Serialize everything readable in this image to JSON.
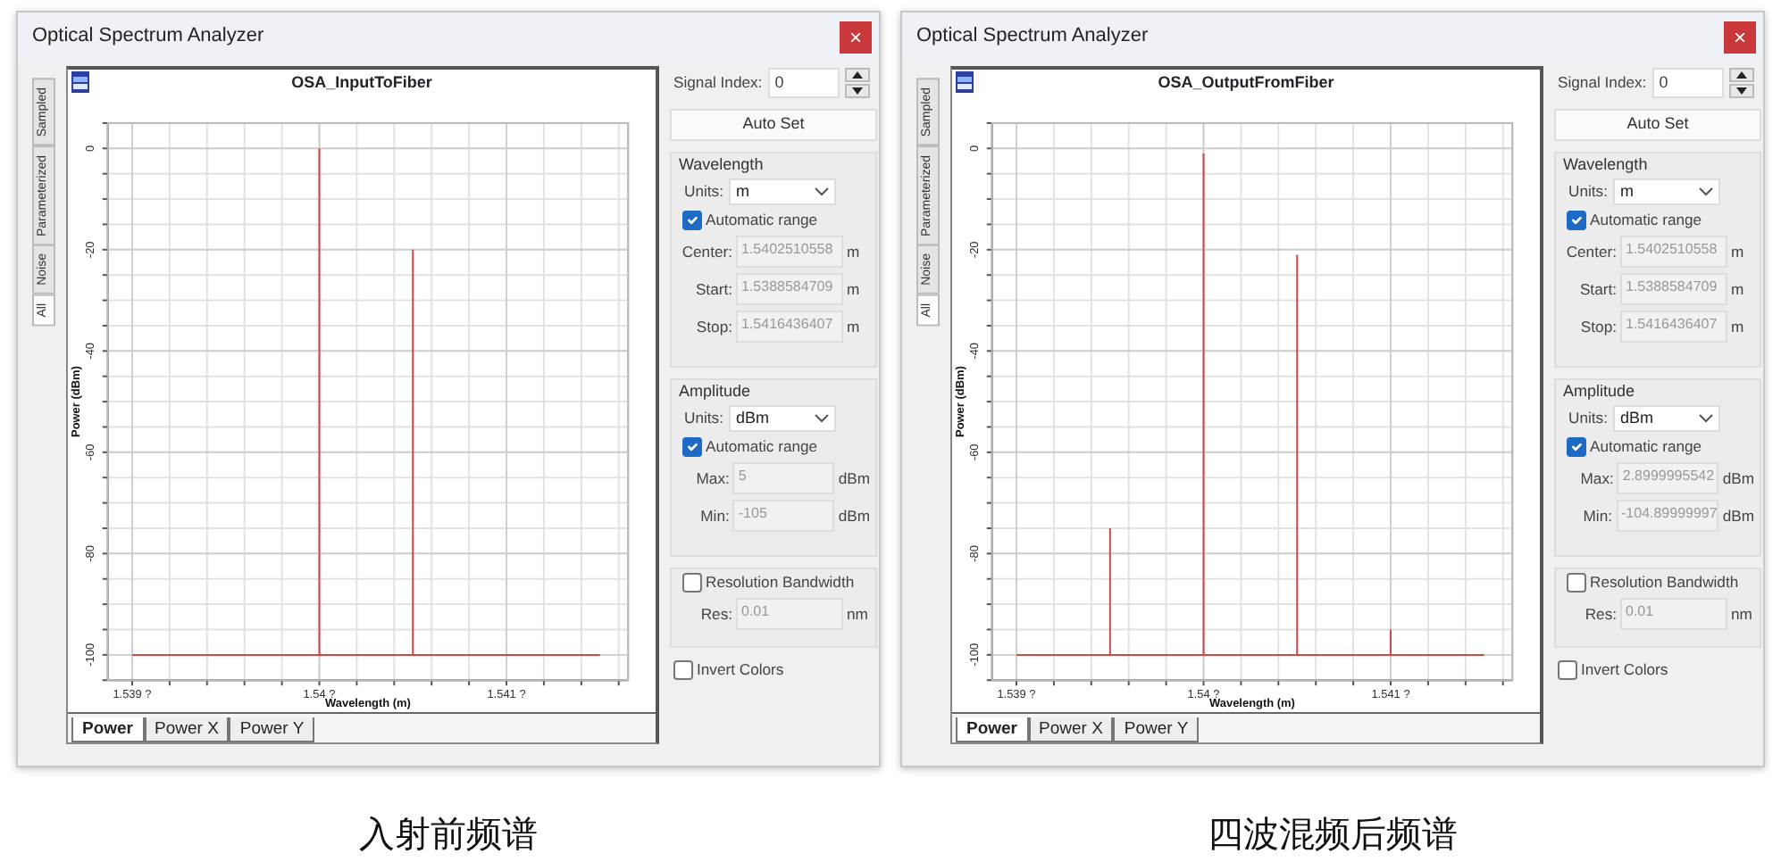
{
  "windows": [
    {
      "title": "Optical Spectrum Analyzer",
      "close": "×",
      "side_tabs": [
        {
          "label": "Sampled",
          "selected": false
        },
        {
          "label": "Parameterized",
          "selected": false
        },
        {
          "label": "Noise",
          "selected": false
        },
        {
          "label": "All",
          "selected": true
        }
      ],
      "plot_title": "OSA_InputToFiber",
      "chart_data": {
        "type": "line",
        "grid": true,
        "xlabel": "Wavelength (m)",
        "ylabel": "Power (dBm)",
        "xlim": [
          1.53887,
          1.54165
        ],
        "ylim": [
          -105,
          5
        ],
        "xticks": [
          {
            "value": 1.539,
            "label": "1.539 ?"
          },
          {
            "value": 1.54,
            "label": "1.54 ?"
          },
          {
            "value": 1.541,
            "label": "1.541 ?"
          }
        ],
        "yticks": [
          0,
          -20,
          -40,
          -60,
          -80,
          -100
        ],
        "x": [
          1.539,
          1.54,
          1.54,
          1.54,
          1.5405,
          1.5405,
          1.5405,
          1.5415
        ],
        "series": [
          {
            "color": "#d04848",
            "values": [
              -100,
              -100,
              0,
              -100,
              -100,
              -20,
              -100,
              -100
            ]
          }
        ]
      },
      "bottom_tabs": [
        {
          "label": "Power",
          "selected": true
        },
        {
          "label": "Power X",
          "selected": false
        },
        {
          "label": "Power Y",
          "selected": false
        }
      ],
      "panel": {
        "signal_index": {
          "label": "Signal Index:",
          "value": "0"
        },
        "auto_set": "Auto Set",
        "groups": [
          {
            "title": "Wavelength",
            "units_label": "Units:",
            "units": "m",
            "automatic_range": {
              "label": "Automatic range",
              "checked": true
            },
            "fields": [
              {
                "label": "Center:",
                "value": "1.5402510558",
                "unit": "m",
                "disabled": true
              },
              {
                "label": "Start:",
                "value": "1.5388584709",
                "unit": "m",
                "disabled": true
              },
              {
                "label": "Stop:",
                "value": "1.5416436407",
                "unit": "m",
                "disabled": true
              }
            ]
          },
          {
            "title": "Amplitude",
            "units_label": "Units:",
            "units": "dBm",
            "automatic_range": {
              "label": "Automatic range",
              "checked": true
            },
            "fields": [
              {
                "label": "Max:",
                "value": "5",
                "unit": "dBm",
                "disabled": true
              },
              {
                "label": "Min:",
                "value": "-105",
                "unit": "dBm",
                "disabled": true
              }
            ]
          }
        ],
        "resolution_bandwidth": {
          "label": "Resolution Bandwidth",
          "checked": false,
          "field": {
            "label": "Res:",
            "value": "0.01",
            "unit": "nm",
            "disabled": true
          }
        },
        "invert_colors": {
          "label": "Invert Colors",
          "checked": false
        }
      },
      "caption": "入射前频谱"
    },
    {
      "title": "Optical Spectrum Analyzer",
      "close": "×",
      "side_tabs": [
        {
          "label": "Sampled",
          "selected": false
        },
        {
          "label": "Parameterized",
          "selected": false
        },
        {
          "label": "Noise",
          "selected": false
        },
        {
          "label": "All",
          "selected": true
        }
      ],
      "plot_title": "OSA_OutputFromFiber",
      "chart_data": {
        "type": "line",
        "grid": true,
        "xlabel": "Wavelength (m)",
        "ylabel": "Power (dBm)",
        "xlim": [
          1.53887,
          1.54165
        ],
        "ylim": [
          -105,
          5
        ],
        "xticks": [
          {
            "value": 1.539,
            "label": "1.539 ?"
          },
          {
            "value": 1.54,
            "label": "1.54 ?"
          },
          {
            "value": 1.541,
            "label": "1.541 ?"
          }
        ],
        "yticks": [
          0,
          -20,
          -40,
          -60,
          -80,
          -100
        ],
        "x": [
          1.539,
          1.5395,
          1.5395,
          1.5395,
          1.54,
          1.54,
          1.54,
          1.5405,
          1.5405,
          1.5405,
          1.541,
          1.541,
          1.541,
          1.5415
        ],
        "series": [
          {
            "color": "#d04848",
            "values": [
              -100,
              -100,
              -75,
              -100,
              -100,
              -1,
              -100,
              -100,
              -21,
              -100,
              -100,
              -95,
              -100,
              -100
            ]
          }
        ]
      },
      "bottom_tabs": [
        {
          "label": "Power",
          "selected": true
        },
        {
          "label": "Power X",
          "selected": false
        },
        {
          "label": "Power Y",
          "selected": false
        }
      ],
      "panel": {
        "signal_index": {
          "label": "Signal Index:",
          "value": "0"
        },
        "auto_set": "Auto Set",
        "groups": [
          {
            "title": "Wavelength",
            "units_label": "Units:",
            "units": "m",
            "automatic_range": {
              "label": "Automatic range",
              "checked": true
            },
            "fields": [
              {
                "label": "Center:",
                "value": "1.5402510558",
                "unit": "m",
                "disabled": true
              },
              {
                "label": "Start:",
                "value": "1.5388584709",
                "unit": "m",
                "disabled": true
              },
              {
                "label": "Stop:",
                "value": "1.5416436407",
                "unit": "m",
                "disabled": true
              }
            ]
          },
          {
            "title": "Amplitude",
            "units_label": "Units:",
            "units": "dBm",
            "automatic_range": {
              "label": "Automatic range",
              "checked": true
            },
            "fields": [
              {
                "label": "Max:",
                "value": "2.8999995542",
                "unit": "dBm",
                "disabled": true
              },
              {
                "label": "Min:",
                "value": "-104.89999997",
                "unit": "dBm",
                "disabled": true
              }
            ]
          }
        ],
        "resolution_bandwidth": {
          "label": "Resolution Bandwidth",
          "checked": false,
          "field": {
            "label": "Res:",
            "value": "0.01",
            "unit": "nm",
            "disabled": true
          }
        },
        "invert_colors": {
          "label": "Invert Colors",
          "checked": false
        }
      },
      "caption": "四波混频后频谱"
    }
  ]
}
